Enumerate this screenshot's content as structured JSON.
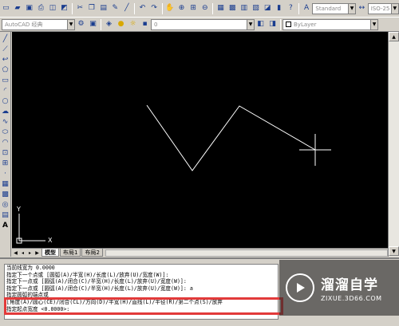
{
  "toolbar_top": {
    "icons": [
      "new-icon",
      "open-icon",
      "save-icon",
      "print-icon",
      "preview-icon",
      "plot-icon",
      "cut-icon",
      "copy-icon",
      "paste-icon",
      "match-icon",
      "brush-icon",
      "undo-icon",
      "redo-icon",
      "pan-icon",
      "zoom-realtime-icon",
      "zoom-window-icon",
      "zoom-previous-icon",
      "properties-icon",
      "design-center-icon",
      "tool-palette-icon",
      "sheet-set-icon",
      "markup-icon",
      "calculator-icon",
      "help-icon",
      "text-style-icon"
    ],
    "text_style_value": "Standard",
    "dim_style_value": "ISO-25"
  },
  "toolbar_second": {
    "workspace_value": "AutoCAD 经典",
    "layer_value": "0",
    "color_value": "ByLayer"
  },
  "left_toolbar": {
    "icons": [
      "line-icon",
      "construction-line-icon",
      "polyline-icon",
      "polygon-icon",
      "rectangle-icon",
      "arc-icon",
      "circle-icon",
      "revision-cloud-icon",
      "spline-icon",
      "ellipse-icon",
      "ellipse-arc-icon",
      "insert-block-icon",
      "make-block-icon",
      "point-icon",
      "hatch-icon",
      "gradient-icon",
      "region-icon",
      "table-icon"
    ],
    "mtext_label": "A"
  },
  "canvas": {
    "ucs_y_label": "Y",
    "ucs_x_label": "X",
    "background": "#000000",
    "line_color": "#ffffff"
  },
  "tabs": {
    "model": "模型",
    "layout1": "布局1",
    "layout2": "布局2"
  },
  "command_window": {
    "lines": [
      "当前线宽为 0.0000",
      "指定下一个点或 [圆弧(A)/半宽(H)/长度(L)/放弃(U)/宽度(W)]:",
      "指定下一点或 [圆弧(A)/闭合(C)/半宽(H)/长度(L)/放弃(U)/宽度(W)]:",
      "指定下一点或 [圆弧(A)/闭合(C)/半宽(H)/长度(L)/放弃(U)/宽度(W)]: a",
      "指定圆弧的端点或",
      "[角度(A)/圆心(CE)/闭合(CL)/方向(D)/半宽(H)/直线(L)/半径(R)/第二个点(S)/放弃",
      "指定起点宽度 <0.0000>:"
    ],
    "highlight_color": "#e23a3a"
  },
  "watermark": {
    "title": "溜溜自学",
    "subtitle": "ZIXUE.3D66.COM"
  }
}
